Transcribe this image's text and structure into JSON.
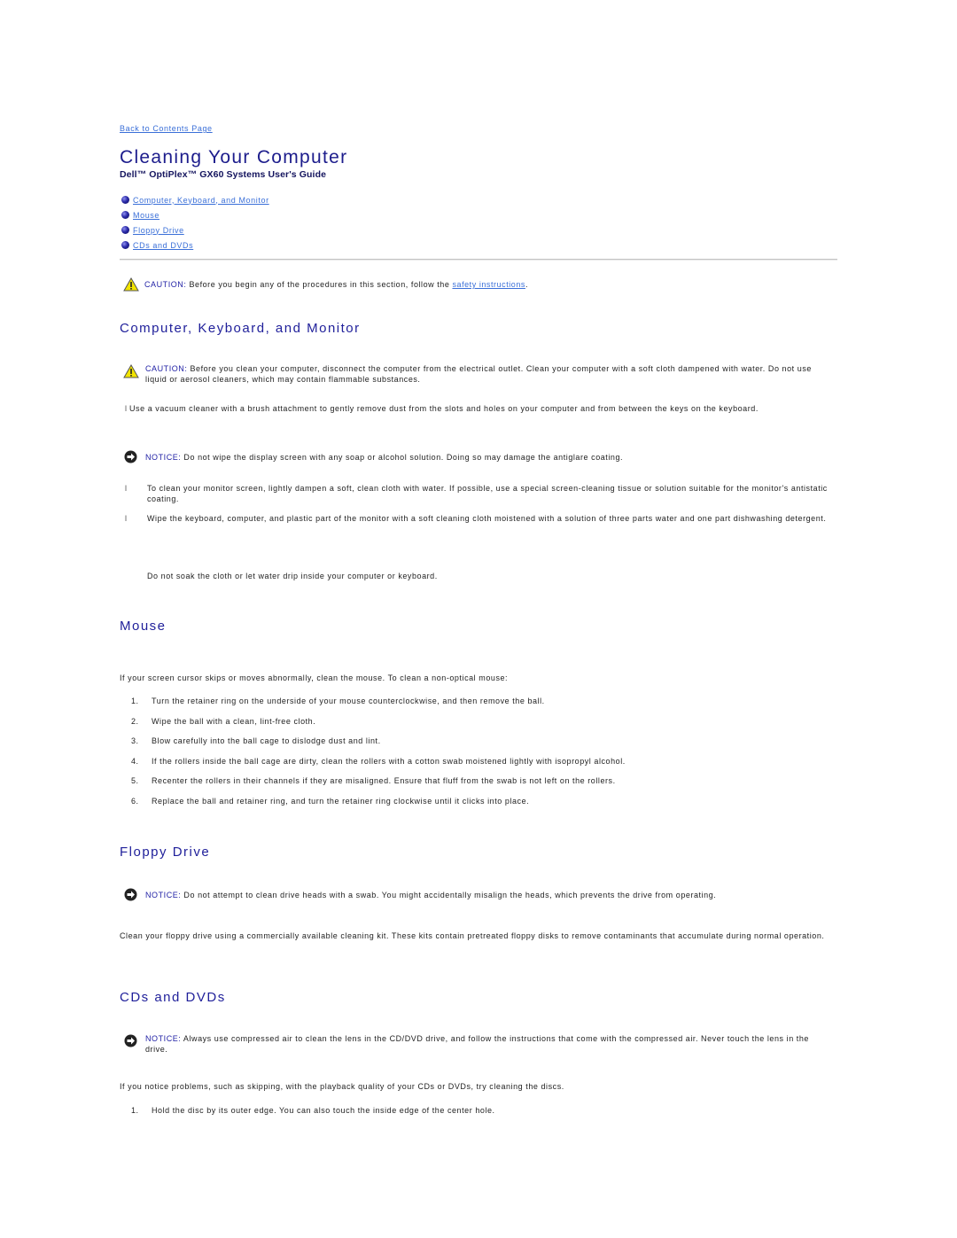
{
  "nav": {
    "back_link": "Back to Contents Page"
  },
  "header": {
    "title": "Cleaning Your Computer",
    "subtitle": "Dell™ OptiPlex™ GX60 Systems User's Guide"
  },
  "toc": [
    {
      "label": "Computer, Keyboard, and Monitor"
    },
    {
      "label": "Mouse"
    },
    {
      "label": "Floppy Drive"
    },
    {
      "label": "CDs and DVDs"
    }
  ],
  "caution_top": {
    "label": "CAUTION:",
    "text_before": " Before you begin any of the procedures in this section, follow the ",
    "link": "safety instructions",
    "text_after": "."
  },
  "sections": {
    "computer": {
      "heading": "Computer, Keyboard, and Monitor",
      "caution": {
        "label": "CAUTION:",
        "text": " Before you clean your computer, disconnect the computer from the electrical outlet. Clean your computer with a soft cloth dampened with water. Do not use liquid or aerosol cleaners, which may contain flammable substances."
      },
      "bullet1": "Use a vacuum cleaner with a brush attachment to gently remove dust from the slots and holes on your computer and from between the keys on the keyboard.",
      "notice": {
        "label": "NOTICE:",
        "text": " Do not wipe the display screen with any soap or alcohol solution. Doing so may damage the antiglare coating."
      },
      "bullet2": "To clean your monitor screen, lightly dampen a soft, clean cloth with water. If possible, use a special screen-cleaning tissue or solution suitable for the monitor's antistatic coating.",
      "bullet3": "Wipe the keyboard, computer, and plastic part of the monitor with a soft cleaning cloth moistened with a solution of three parts water and one part dishwashing detergent.",
      "note": "Do not soak the cloth or let water drip inside your computer or keyboard."
    },
    "mouse": {
      "heading": "Mouse",
      "intro": "If your screen cursor skips or moves abnormally, clean the mouse. To clean a non-optical mouse:",
      "steps": [
        {
          "num": "1.",
          "text": "Turn the retainer ring on the underside of your mouse counterclockwise, and then remove the ball."
        },
        {
          "num": "2.",
          "text": "Wipe the ball with a clean, lint-free cloth."
        },
        {
          "num": "3.",
          "text": "Blow carefully into the ball cage to dislodge dust and lint."
        },
        {
          "num": "4.",
          "text": "If the rollers inside the ball cage are dirty, clean the rollers with a cotton swab moistened lightly with isopropyl alcohol."
        },
        {
          "num": "5.",
          "text": "Recenter the rollers in their channels if they are misaligned. Ensure that fluff from the swab is not left on the rollers."
        },
        {
          "num": "6.",
          "text": "Replace the ball and retainer ring, and turn the retainer ring clockwise until it clicks into place."
        }
      ]
    },
    "floppy": {
      "heading": "Floppy Drive",
      "notice": {
        "label": "NOTICE:",
        "text": " Do not attempt to clean drive heads with a swab. You might accidentally misalign the heads, which prevents the drive from operating."
      },
      "text": "Clean your floppy drive using a commercially available cleaning kit. These kits contain pretreated floppy disks to remove contaminants that accumulate during normal operation."
    },
    "cds": {
      "heading": "CDs and DVDs",
      "notice": {
        "label": "NOTICE:",
        "text": " Always use compressed air to clean the lens in the CD/DVD drive, and follow the instructions that come with the compressed air. Never touch the lens in the drive."
      },
      "intro": "If you notice problems, such as skipping, with the playback quality of your CDs or DVDs, try cleaning the discs.",
      "steps": [
        {
          "num": "1.",
          "text": "Hold the disc by its outer edge. You can also touch the inside edge of the center hole."
        }
      ]
    }
  },
  "colors": {
    "heading": "#1f1f9a",
    "link": "#3a6fd8",
    "label": "#2222a6",
    "warning_yellow": "#f2e400"
  },
  "icons": {
    "caution": "warning-triangle-icon",
    "notice": "arrow-circle-icon",
    "toc_bullet": "blue-ball-bullet-icon"
  }
}
